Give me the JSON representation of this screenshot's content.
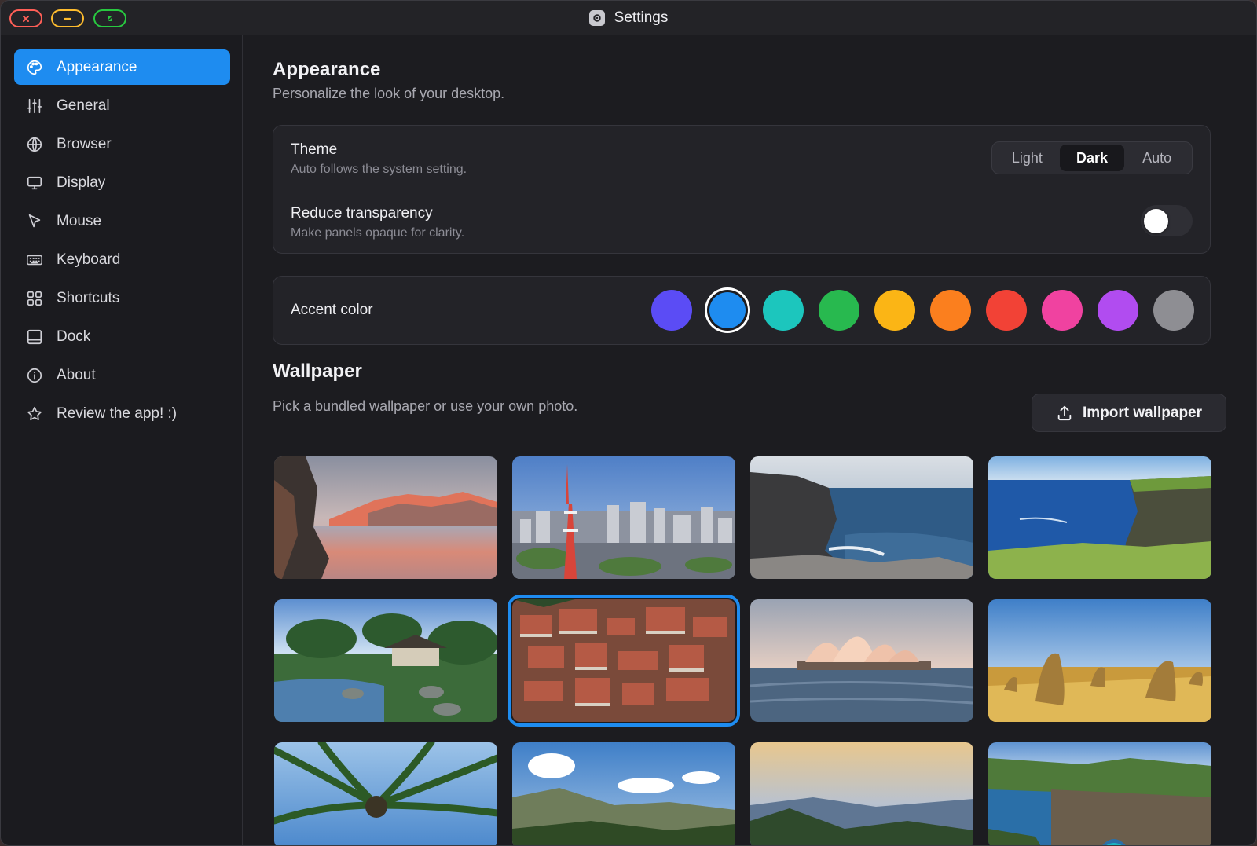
{
  "window": {
    "title": "Settings"
  },
  "sidebar": {
    "items": [
      {
        "label": "Appearance",
        "icon": "palette-icon",
        "active": true
      },
      {
        "label": "General",
        "icon": "sliders-icon"
      },
      {
        "label": "Browser",
        "icon": "globe-icon"
      },
      {
        "label": "Display",
        "icon": "monitor-icon"
      },
      {
        "label": "Mouse",
        "icon": "pointer-icon"
      },
      {
        "label": "Keyboard",
        "icon": "keyboard-icon"
      },
      {
        "label": "Shortcuts",
        "icon": "grid-icon"
      },
      {
        "label": "Dock",
        "icon": "dock-icon"
      },
      {
        "label": "About",
        "icon": "info-icon"
      },
      {
        "label": "Review the app! :)",
        "icon": "star-icon"
      }
    ]
  },
  "page": {
    "title": "Appearance",
    "subtitle": "Personalize the look of your desktop."
  },
  "theme": {
    "title": "Theme",
    "desc": "Auto follows the system setting.",
    "options": [
      "Light",
      "Dark",
      "Auto"
    ],
    "selected": "Dark"
  },
  "transparency": {
    "title": "Reduce transparency",
    "desc": "Make panels opaque for clarity.",
    "enabled": false
  },
  "accent": {
    "label": "Accent color",
    "colors": [
      "#5b4cf5",
      "#1e8cf0",
      "#1cc6bd",
      "#28b94f",
      "#fbb515",
      "#fb7f1e",
      "#f24236",
      "#f042a0",
      "#b14cf0",
      "#8e8e93"
    ],
    "selected_index": 1
  },
  "wallpaper": {
    "title": "Wallpaper",
    "subtitle": "Pick a bundled wallpaper or use your own photo.",
    "import_label": "Import wallpaper",
    "selected_index": 5,
    "tiles": [
      "mountain-lake-sunset",
      "tokyo-tower-city",
      "rocky-coast",
      "sea-cliffs",
      "japanese-garden",
      "old-town-rooftops",
      "sydney-opera-house",
      "desert-pinnacles",
      "palm-trees",
      "valley-mountains",
      "misty-hills",
      "coastal-arch"
    ]
  },
  "ui_colors": {
    "accent": "#1e8cf0",
    "background": "#1c1c20",
    "card": "#232328"
  }
}
